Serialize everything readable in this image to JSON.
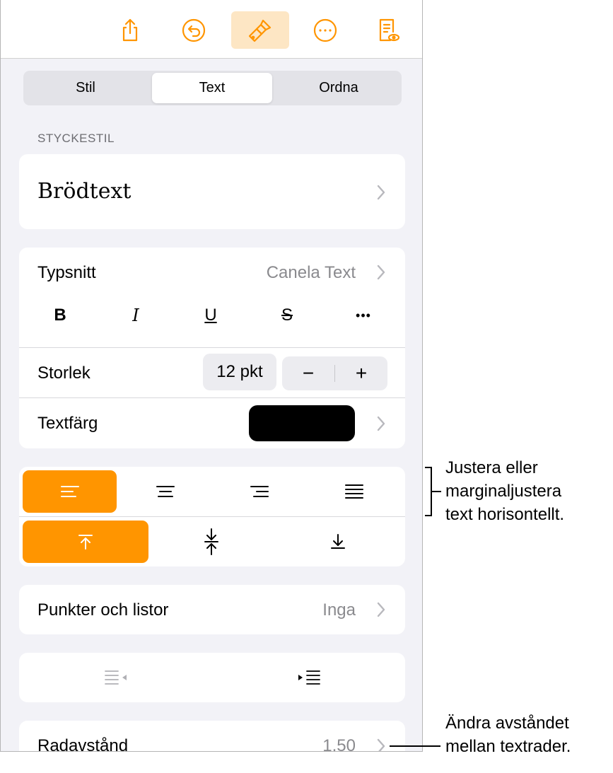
{
  "tabs": [
    "Stil",
    "Text",
    "Ordna"
  ],
  "selected_tab": "Text",
  "paragraph_style": {
    "header": "STYCKESTIL",
    "value": "Brödtext"
  },
  "font": {
    "label": "Typsnitt",
    "value": "Canela Text",
    "bold": "B",
    "italic": "I",
    "underline": "U",
    "strike": "S",
    "more": "•••"
  },
  "size": {
    "label": "Storlek",
    "value": "12 pkt",
    "minus": "−",
    "plus": "+"
  },
  "text_color": {
    "label": "Textfärg",
    "color": "#000000"
  },
  "bullets": {
    "label": "Punkter och listor",
    "value": "Inga"
  },
  "line_spacing": {
    "label": "Radavstånd",
    "value": "1,50"
  },
  "accent": "#ff9500",
  "annotations": {
    "alignment": [
      "Justera eller",
      "marginaljustera",
      "text horisontellt."
    ],
    "spacing": [
      "Ändra avståndet",
      "mellan textrader."
    ]
  },
  "toolbar_icons": [
    "share-icon",
    "undo-icon",
    "format-brush-icon",
    "more-icon",
    "reader-view-icon"
  ]
}
